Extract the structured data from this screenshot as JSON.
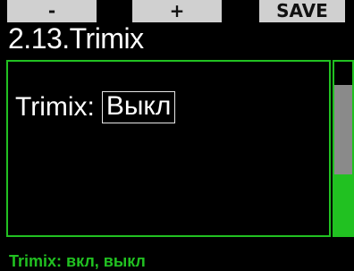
{
  "softkeys": {
    "minus": "-",
    "plus": "+",
    "save": "SAVE"
  },
  "header": {
    "title": "2.13.Trimix"
  },
  "setting": {
    "label": "Trimix:",
    "value": "Выкл"
  },
  "footer": {
    "hint": "Trimix: вкл, выкл"
  },
  "scrollbar": {
    "position_fraction": 0.64
  },
  "colors": {
    "accent": "#21c121",
    "softkey_bg": "#d0d0d0",
    "background": "#000000"
  }
}
